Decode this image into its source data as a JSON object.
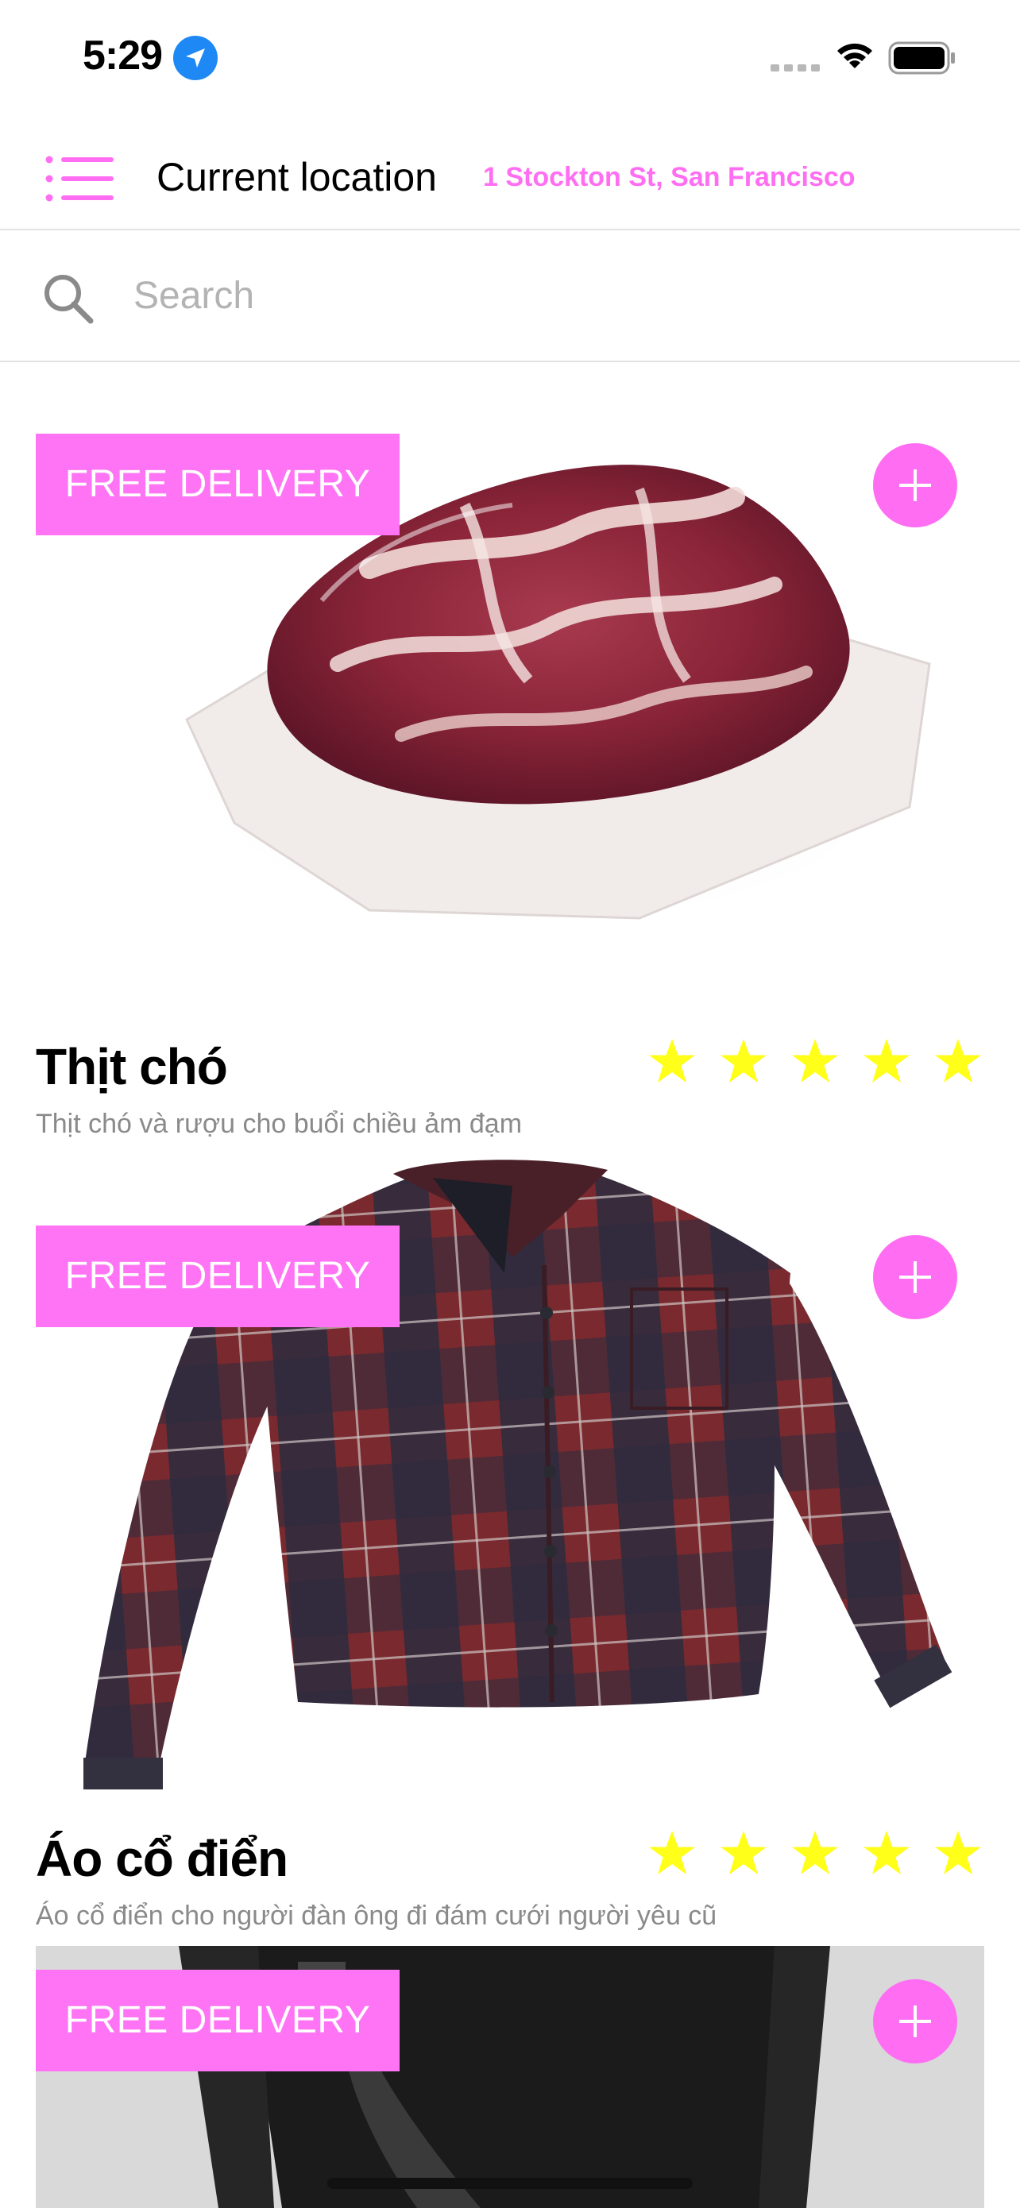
{
  "status_bar": {
    "time": "5:29"
  },
  "header": {
    "location_label": "Current location",
    "location_value": "1 Stockton St, San Francisco"
  },
  "search": {
    "placeholder": "Search",
    "value": ""
  },
  "colors": {
    "accent": "#ff6ef2",
    "badge": "#ff73f5",
    "star": "#ffff1a",
    "description": "#8a8a8a"
  },
  "products": [
    {
      "badge": "FREE DELIVERY",
      "title": "Thịt chó",
      "description": "Thịt chó và rượu cho buổi chiều ảm đạm",
      "rating": 5,
      "rating_max": 5,
      "image_icon": "meat-image"
    },
    {
      "badge": "FREE DELIVERY",
      "title": "Áo cổ điển",
      "description": "Áo cổ điển cho người đàn ông đi đám cưới người yêu cũ",
      "rating": 5,
      "rating_max": 5,
      "image_icon": "plaid-shirt-image"
    },
    {
      "badge": "FREE DELIVERY",
      "image_icon": "black-jacket-image"
    }
  ]
}
